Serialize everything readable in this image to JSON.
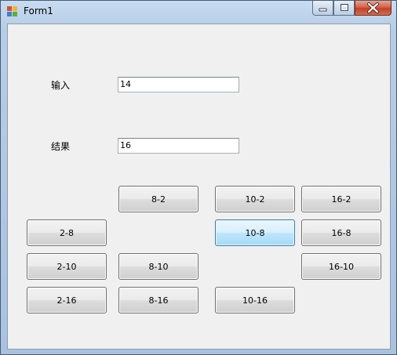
{
  "window": {
    "title": "Form1"
  },
  "labels": {
    "input": "输入",
    "result": "结果"
  },
  "fields": {
    "input_value": "14",
    "result_value": "16"
  },
  "buttons": {
    "b8_2": "8-2",
    "b10_2": "10-2",
    "b16_2": "16-2",
    "b2_8": "2-8",
    "b10_8": "10-8",
    "b16_8": "16-8",
    "b2_10": "2-10",
    "b8_10": "8-10",
    "b16_10": "16-10",
    "b2_16": "2-16",
    "b8_16": "8-16",
    "b10_16": "10-16"
  },
  "icons": [
    "app-icon",
    "minimize-icon",
    "maximize-icon",
    "close-icon"
  ]
}
